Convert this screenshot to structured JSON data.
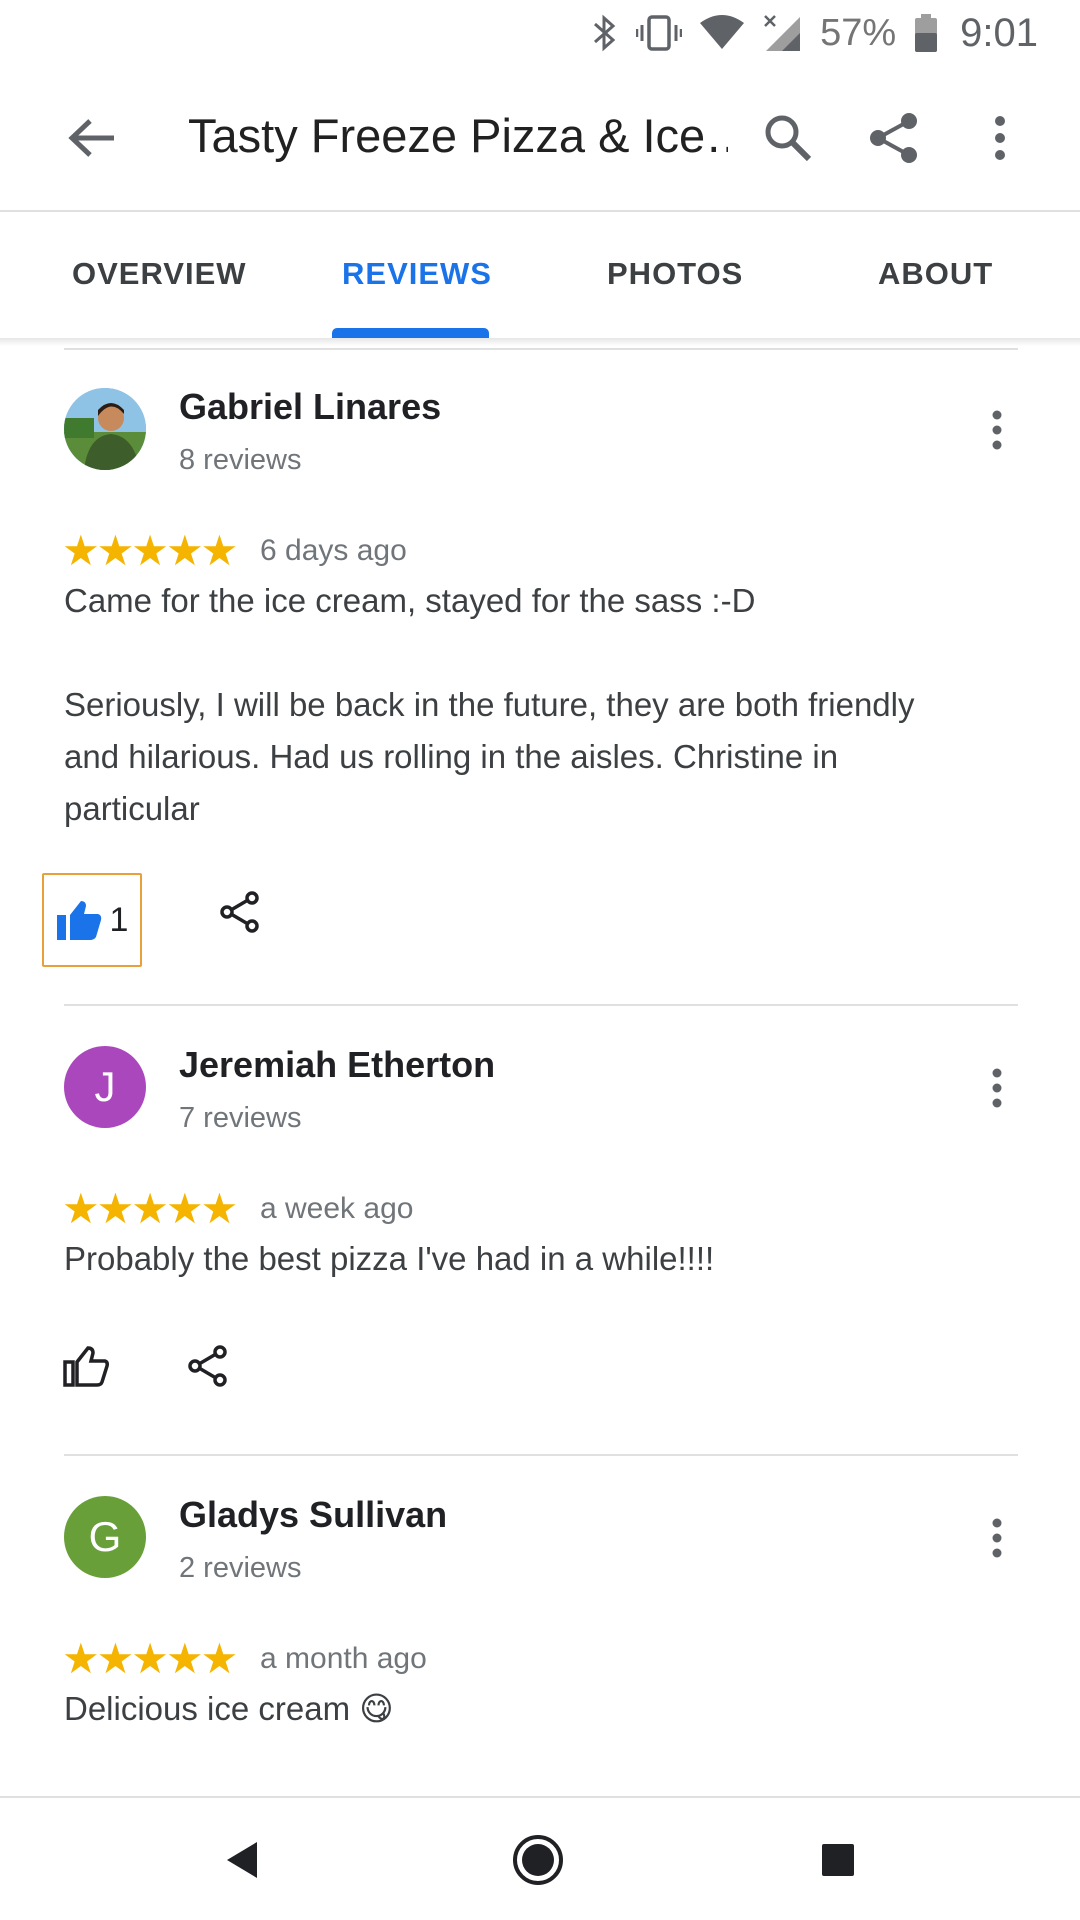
{
  "status_bar": {
    "battery": "57%",
    "time": "9:01"
  },
  "app_bar": {
    "title": "Tasty Freeze Pizza & Ice…"
  },
  "tabs": [
    {
      "label": "OVERVIEW",
      "active": false
    },
    {
      "label": "REVIEWS",
      "active": true
    },
    {
      "label": "PHOTOS",
      "active": false
    },
    {
      "label": "ABOUT",
      "active": false
    }
  ],
  "reviews": [
    {
      "name": "Gabriel Linares",
      "review_count": "8 reviews",
      "rating": 5,
      "time": "6 days ago",
      "text": "Came for the ice cream, stayed for the sass :-D\n\nSeriously, I will be back in the future, they are both friendly and hilarious. Had us rolling in the aisles. Christine in particular",
      "likes": "1",
      "liked": true,
      "avatar_type": "photo"
    },
    {
      "name": "Jeremiah Etherton",
      "review_count": "7 reviews",
      "rating": 5,
      "time": "a week ago",
      "text": "Probably the best pizza I've had in a while!!!!",
      "liked": false,
      "avatar_letter": "J",
      "avatar_color": "#ab47bc"
    },
    {
      "name": "Gladys Sullivan",
      "review_count": "2 reviews",
      "rating": 5,
      "time": "a month ago",
      "text": "Delicious ice cream 😋",
      "liked": false,
      "avatar_letter": "G",
      "avatar_color": "#689f38"
    }
  ],
  "stars_glyph": "★★★★★",
  "colors": {
    "accent": "#1a73e8",
    "star": "#f5b400",
    "focus_outline": "#e8a13a"
  }
}
